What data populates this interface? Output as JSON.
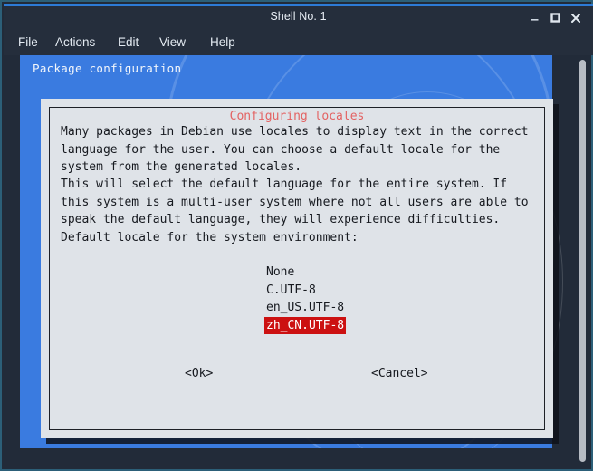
{
  "window": {
    "title": "Shell No. 1",
    "controls": [
      {
        "name": "minimize",
        "glyph": "—"
      },
      {
        "name": "maximize",
        "glyph": "□"
      },
      {
        "name": "close",
        "glyph": "✕"
      }
    ]
  },
  "menubar": {
    "items": [
      {
        "label": "File"
      },
      {
        "label": "Actions"
      },
      {
        "label": "Edit"
      },
      {
        "label": "View"
      },
      {
        "label": "Help"
      }
    ]
  },
  "terminal": {
    "screen_title": "Package configuration",
    "dialog": {
      "legend": "Configuring locales",
      "paragraphs": [
        "Many packages in Debian use locales to display text in the correct\nlanguage for the user. You can choose a default locale for the\nsystem from the generated locales.",
        "This will select the default language for the entire system. If\nthis system is a multi-user system where not all users are able to\nspeak the default language, they will experience difficulties.",
        "Default locale for the system environment:"
      ],
      "locales": [
        {
          "label": "None",
          "selected": false
        },
        {
          "label": "C.UTF-8",
          "selected": false
        },
        {
          "label": "en_US.UTF-8",
          "selected": false
        },
        {
          "label": "zh_CN.UTF-8",
          "selected": true
        }
      ],
      "buttons": {
        "ok": "<Ok>",
        "cancel": "<Cancel>"
      }
    }
  },
  "colors": {
    "titlebar_bg": "#252e3c",
    "accent_blue": "#2d7bd6",
    "dialog_blue_bg": "#3a7be0",
    "dialog_grey_bg": "#dfe3e8",
    "legend_red": "#e36363",
    "selection_red": "#cc1111",
    "text_dark": "#16191f",
    "scrollbar_thumb": "#b7bcc4"
  }
}
